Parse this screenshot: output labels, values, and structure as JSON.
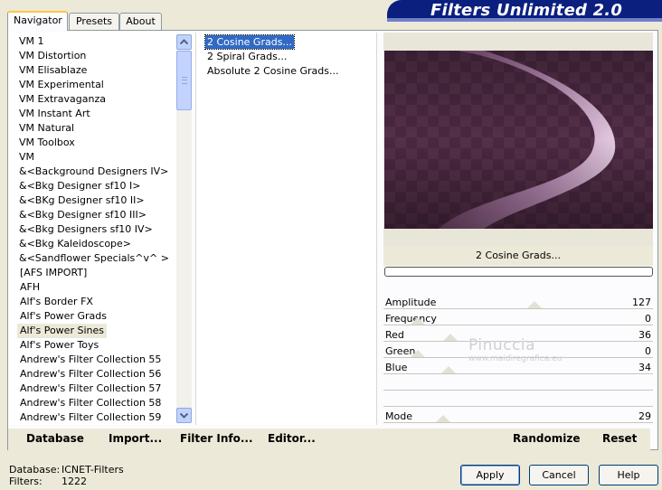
{
  "tabs": [
    {
      "label": "Navigator"
    },
    {
      "label": "Presets"
    },
    {
      "label": "About"
    }
  ],
  "title": "Filters Unlimited 2.0",
  "categories": [
    {
      "label": "VM 1"
    },
    {
      "label": "VM Distortion"
    },
    {
      "label": "VM Elisablaze"
    },
    {
      "label": "VM Experimental"
    },
    {
      "label": "VM Extravaganza"
    },
    {
      "label": "VM Instant Art"
    },
    {
      "label": "VM Natural"
    },
    {
      "label": "VM Toolbox"
    },
    {
      "label": "VM"
    },
    {
      "label": "&<Background Designers IV>"
    },
    {
      "label": "&<Bkg Designer sf10 I>"
    },
    {
      "label": "&<BKg Designer sf10 II>"
    },
    {
      "label": "&<Bkg Designer sf10 III>"
    },
    {
      "label": "&<Bkg Designers sf10 IV>"
    },
    {
      "label": "&<Bkg Kaleidoscope>"
    },
    {
      "label": "&<Sandflower Specials^v^ >"
    },
    {
      "label": "[AFS IMPORT]"
    },
    {
      "label": "AFH"
    },
    {
      "label": "Alf's Border FX"
    },
    {
      "label": "Alf's Power Grads"
    },
    {
      "label": "Alf's Power Sines"
    },
    {
      "label": "Alf's Power Toys"
    },
    {
      "label": "Andrew's Filter Collection 55"
    },
    {
      "label": "Andrew's Filter Collection 56"
    },
    {
      "label": "Andrew's Filter Collection 57"
    },
    {
      "label": "Andrew's Filter Collection 58"
    },
    {
      "label": "Andrew's Filter Collection 59"
    }
  ],
  "filters": [
    {
      "label": "2 Cosine Grads..."
    },
    {
      "label": "2 Spiral Grads..."
    },
    {
      "label": "Absolute 2 Cosine Grads..."
    }
  ],
  "preview": {
    "filter_name": "2 Cosine Grads...",
    "progress": 0
  },
  "params": [
    {
      "label": "Amplitude",
      "value": "127",
      "fraction": 0.5
    },
    {
      "label": "Frequency",
      "value": "0",
      "fraction": 0.0
    },
    {
      "label": "Red",
      "value": "36",
      "fraction": 0.14
    },
    {
      "label": "Green",
      "value": "0",
      "fraction": 0.0
    },
    {
      "label": "Blue",
      "value": "34",
      "fraction": 0.13
    },
    {
      "label": "",
      "value": "",
      "fraction": null
    },
    {
      "label": "",
      "value": "",
      "fraction": null
    },
    {
      "label": "Mode",
      "value": "29",
      "fraction": 0.11
    }
  ],
  "toolbar": {
    "database": "Database",
    "import": "Import...",
    "filter_info": "Filter Info...",
    "editor": "Editor...",
    "randomize": "Randomize",
    "reset": "Reset"
  },
  "info": {
    "database_label": "Database:",
    "database_value": "ICNET-Filters",
    "filters_label": "Filters:",
    "filters_value": "1222"
  },
  "buttons": {
    "apply": "Apply",
    "cancel": "Cancel",
    "help": "Help"
  },
  "watermark": {
    "name": "Pinuccia",
    "url": "www.maidiregrafica.eu"
  },
  "colors": {
    "selection": "#316ac5",
    "preview_dark": "#5a2d50",
    "preview_light": "#d6a8d2"
  }
}
